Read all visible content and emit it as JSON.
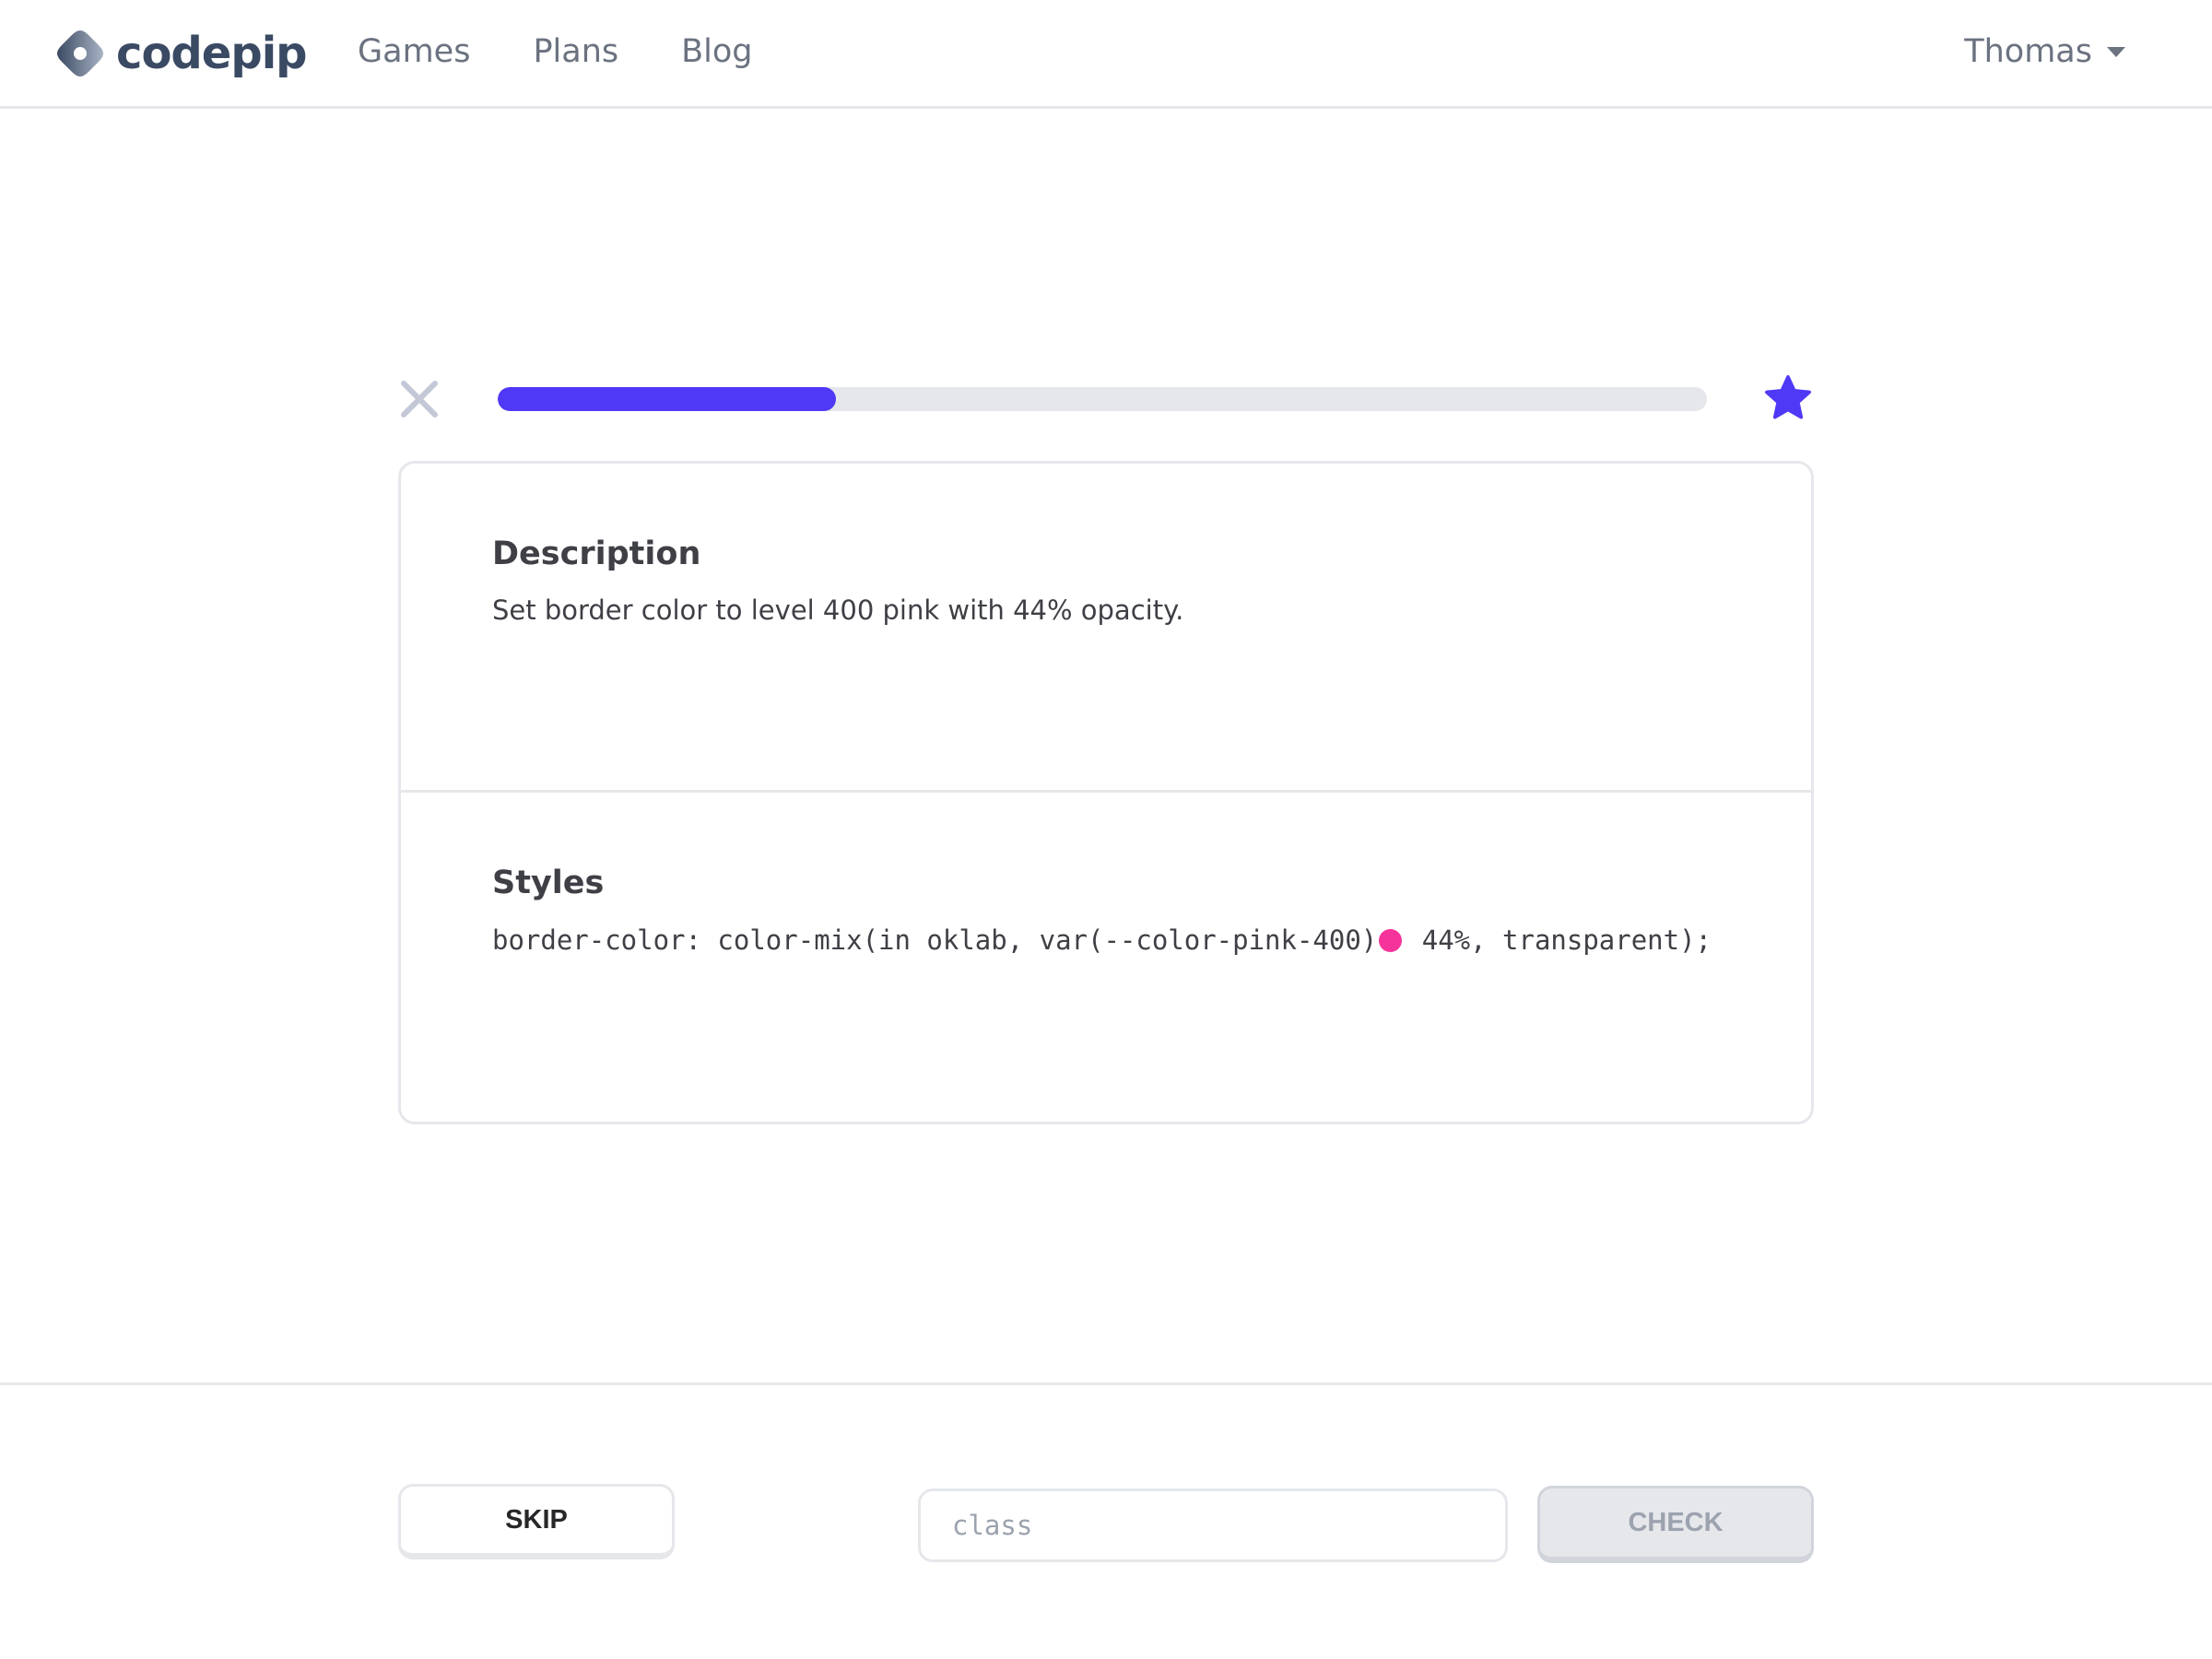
{
  "brand": {
    "name": "codepip"
  },
  "nav": {
    "items": [
      "Games",
      "Plans",
      "Blog"
    ]
  },
  "user": {
    "name": "Thomas"
  },
  "progress": {
    "fraction": 0.28,
    "color": "#4f39f6"
  },
  "description": {
    "heading": "Description",
    "text": "Set border color to level 400 pink with 44% opacity."
  },
  "styles": {
    "heading": "Styles",
    "code_before": "border-color: color-mix(in oklab, var(--color-pink-400)",
    "code_after": " 44%, transparent);",
    "swatch_color": "#f6339a"
  },
  "actions": {
    "skip_label": "SKIP",
    "input_placeholder": "class",
    "check_label": "CHECK"
  }
}
